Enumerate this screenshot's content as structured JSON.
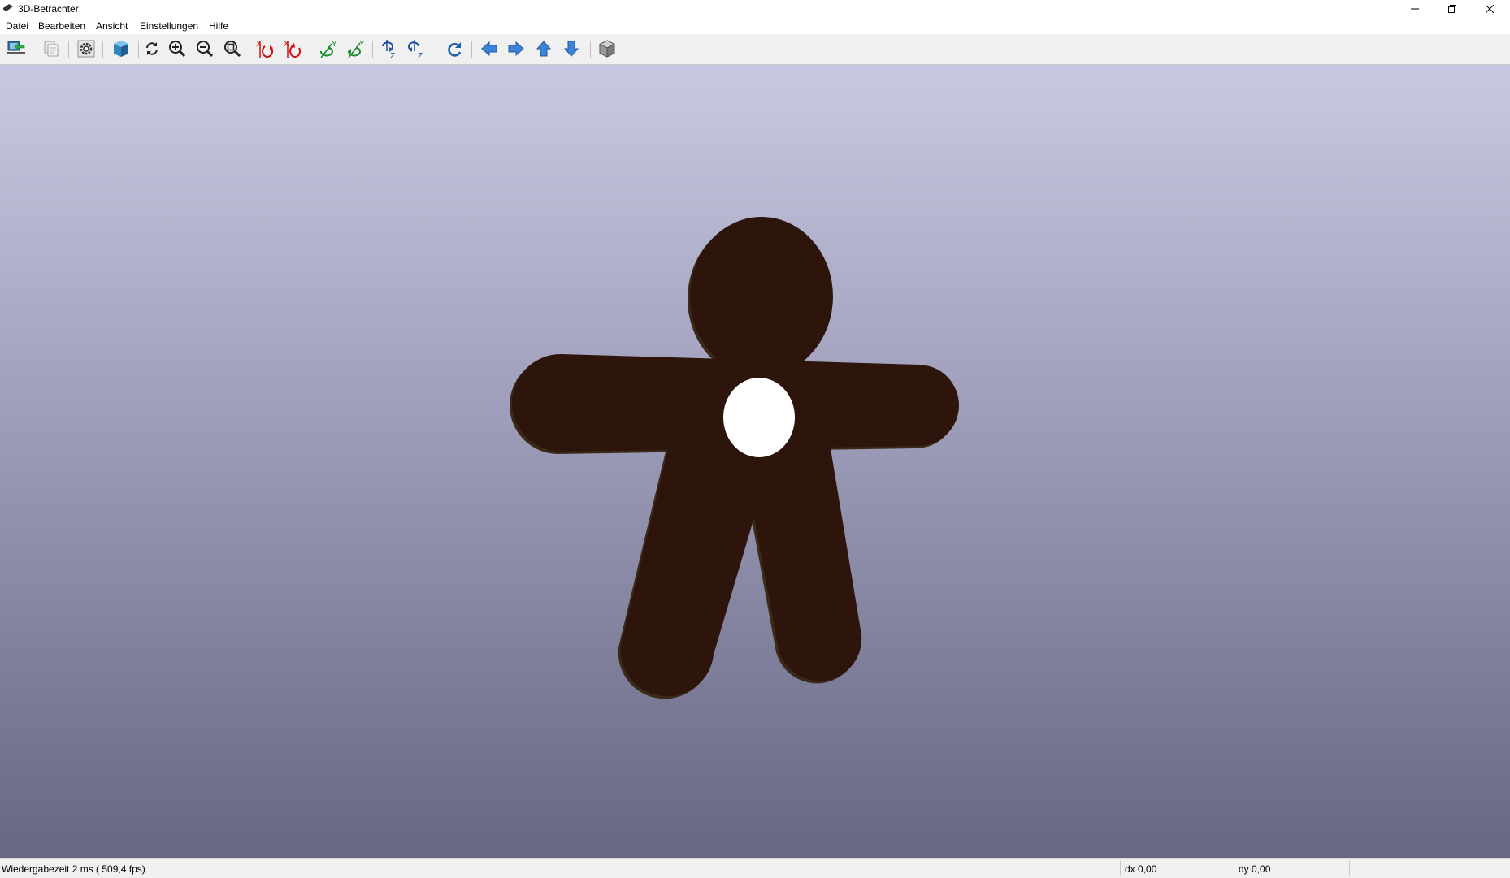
{
  "window": {
    "title": "3D-Betrachter",
    "controls": {
      "minimize": "minimize-icon",
      "restore": "restore-icon",
      "close": "close-icon"
    }
  },
  "menu": [
    "Datei",
    "Bearbeiten",
    "Ansicht",
    "Einstellungen",
    "Hilfe"
  ],
  "toolbar": {
    "buttons": [
      "export-icon",
      "copy-icon",
      "settings-gear-icon",
      "3d-box-icon",
      "reload-icon",
      "zoom-in-icon",
      "zoom-out-icon",
      "zoom-fit-icon",
      "rotate-x-cw-icon",
      "rotate-x-ccw-icon",
      "rotate-y-cw-icon",
      "rotate-y-ccw-icon",
      "rotate-z-cw-icon",
      "rotate-z-ccw-icon",
      "redo-icon",
      "arrow-left-icon",
      "arrow-right-icon",
      "arrow-up-icon",
      "arrow-down-icon",
      "ortho-cube-icon"
    ],
    "axis_labels": {
      "x": "X",
      "y": "Y",
      "z": "Z"
    }
  },
  "viewport": {
    "background_top": "#c9c9e3",
    "background_bottom": "#676783",
    "model_color": "#2d150c",
    "hole_color": "#ffffff"
  },
  "status": {
    "render_time": "Wiedergabezeit 2 ms ( 509,4 fps)",
    "dx": "dx 0,00",
    "dy": "dy 0,00"
  }
}
